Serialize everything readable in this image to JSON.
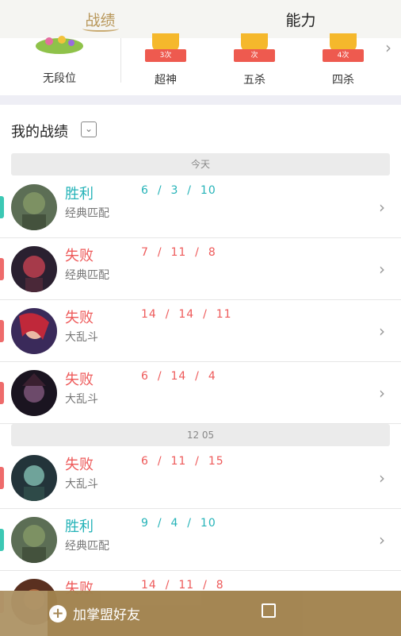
{
  "tabs": [
    {
      "label": "战绩",
      "active": true
    },
    {
      "label": "能力",
      "active": false
    }
  ],
  "ranks": [
    {
      "label": "无段位",
      "badge": ""
    },
    {
      "label": "超神",
      "badge": "3次"
    },
    {
      "label": "五杀",
      "badge": "次"
    },
    {
      "label": "四杀",
      "badge": "4次"
    }
  ],
  "records": {
    "title": "我的战绩",
    "groups": [
      {
        "date": "今天"
      },
      {
        "date": "12 05"
      }
    ],
    "matches": [
      {
        "result": "胜利",
        "mode": "经典匹配",
        "kills": "6",
        "deaths": "3",
        "assists": "10",
        "status": "win"
      },
      {
        "result": "失败",
        "mode": "经典匹配",
        "kills": "7",
        "deaths": "11",
        "assists": "8",
        "status": "lose"
      },
      {
        "result": "失败",
        "mode": "大乱斗",
        "kills": "14",
        "deaths": "14",
        "assists": "11",
        "status": "lose"
      },
      {
        "result": "失败",
        "mode": "大乱斗",
        "kills": "6",
        "deaths": "14",
        "assists": "4",
        "status": "lose"
      },
      {
        "result": "失败",
        "mode": "大乱斗",
        "kills": "6",
        "deaths": "11",
        "assists": "15",
        "status": "lose"
      },
      {
        "result": "胜利",
        "mode": "经典匹配",
        "kills": "9",
        "deaths": "4",
        "assists": "10",
        "status": "win"
      },
      {
        "result": "失败",
        "mode": "",
        "kills": "14",
        "deaths": "11",
        "assists": "8",
        "status": "lose"
      }
    ]
  },
  "bottom": {
    "add_friend": "加掌盟好友"
  },
  "colors": {
    "accent": "#b8975a",
    "win": "#25b3b8",
    "lose": "#ee5a5a",
    "bottom_bar": "#a2834e"
  }
}
